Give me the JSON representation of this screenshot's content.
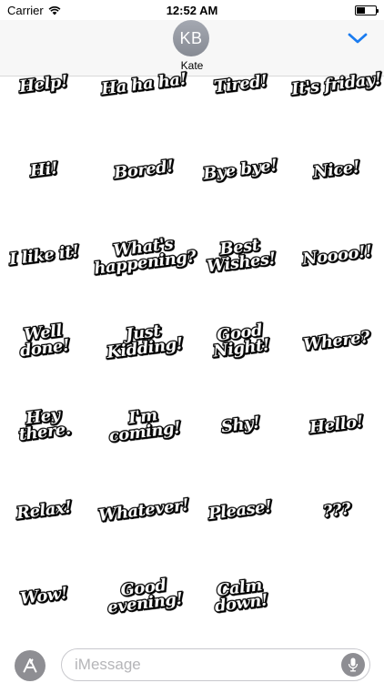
{
  "status_bar": {
    "carrier": "Carrier",
    "time": "12:52 AM",
    "wifi_icon": "wifi-icon",
    "battery_icon": "battery-icon"
  },
  "header": {
    "avatar_initials": "KB",
    "contact_name": "Kate",
    "collapse_icon": "chevron-down-icon",
    "accent_color": "#1a7cf0"
  },
  "stickers": [
    {
      "label": "Help!"
    },
    {
      "label": "Ha ha ha!"
    },
    {
      "label": "Tired!"
    },
    {
      "label": "It's friday!"
    },
    {
      "label": "Hi!"
    },
    {
      "label": "Bored!"
    },
    {
      "label": "Bye bye!"
    },
    {
      "label": "Nice!"
    },
    {
      "label": "I like it!"
    },
    {
      "label": "What's\nhappening?"
    },
    {
      "label": "Best\nWishes!"
    },
    {
      "label": "Noooo!!"
    },
    {
      "label": "Well done!"
    },
    {
      "label": "Just\nKidding!"
    },
    {
      "label": "Good\nNight!"
    },
    {
      "label": "Where?"
    },
    {
      "label": "Hey there."
    },
    {
      "label": "I'm coming!"
    },
    {
      "label": "Shy!"
    },
    {
      "label": "Hello!"
    },
    {
      "label": "Relax!"
    },
    {
      "label": "Whatever!"
    },
    {
      "label": "Please!"
    },
    {
      "label": "???"
    },
    {
      "label": "Wow!"
    },
    {
      "label": "Good\nevening!"
    },
    {
      "label": "Calm down!"
    }
  ],
  "bottom_bar": {
    "app_store_icon": "app-store-icon",
    "message_placeholder": "iMessage",
    "mic_icon": "microphone-icon"
  }
}
